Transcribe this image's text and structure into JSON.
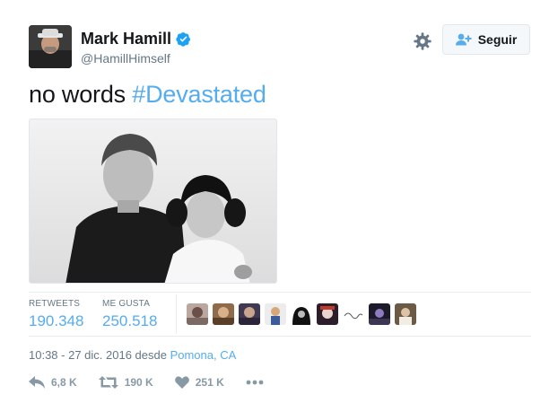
{
  "author": {
    "name": "Mark Hamill",
    "handle": "@HamillHimself",
    "verified": true
  },
  "header": {
    "follow_label": "Seguir",
    "settings_icon": "gear-icon",
    "follow_icon": "user-plus-icon"
  },
  "tweet": {
    "text": "no words ",
    "hashtag": "#Devastated",
    "image_description": "black-and-white photo"
  },
  "stats": {
    "retweets_label": "RETWEETS",
    "retweets_value": "190.348",
    "likes_label": "ME GUSTA",
    "likes_value": "250.518",
    "liker_count": 9
  },
  "meta": {
    "timestamp": "10:38 - 27 dic. 2016 desde ",
    "location": "Pomona, CA"
  },
  "actions": {
    "reply_count": "6,8 K",
    "retweet_count": "190 K",
    "like_count": "251 K",
    "more_icon": "more-icon"
  },
  "colors": {
    "accent": "#55acee",
    "muted": "#657786",
    "icon_gray": "#8899a6",
    "text": "#14171a"
  }
}
